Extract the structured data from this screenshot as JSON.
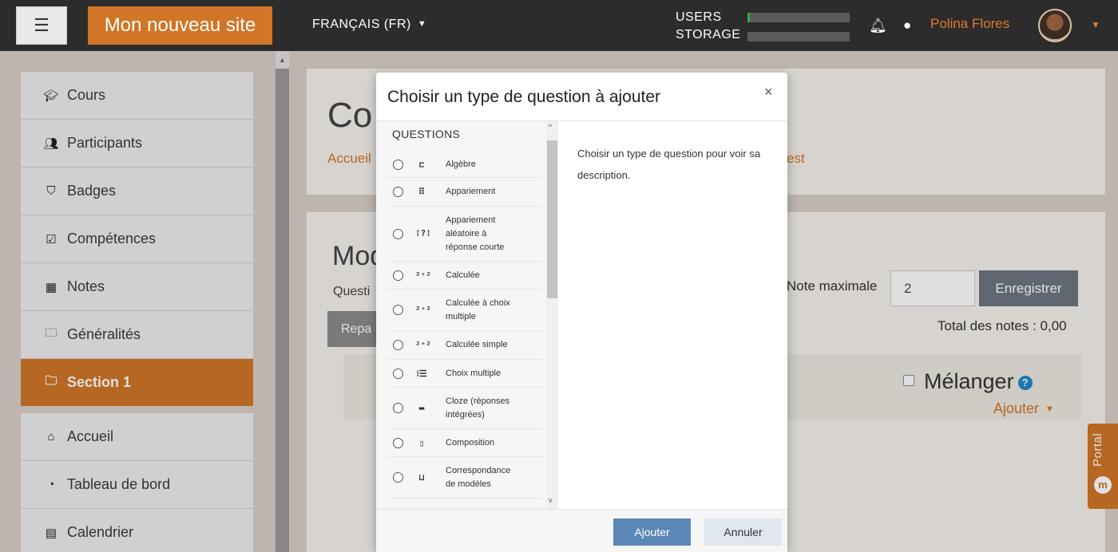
{
  "navbar": {
    "menu_icon": "hamburger-icon",
    "site_name": "Mon nouveau site",
    "language": "FRANÇAIS (FR)",
    "usage": {
      "users_label": "USERS",
      "storage_label": "STORAGE",
      "users_fraction": 0.02,
      "storage_fraction": 0.0,
      "bar_color": "#2fa84f"
    },
    "user_name": "Polina Flores",
    "brand_color": "#d07626"
  },
  "sidebar": {
    "items": [
      {
        "label": "Cours",
        "icon": "graduation-cap-icon"
      },
      {
        "label": "Participants",
        "icon": "users-icon"
      },
      {
        "label": "Badges",
        "icon": "shield-icon"
      },
      {
        "label": "Compétences",
        "icon": "checkbox-icon"
      },
      {
        "label": "Notes",
        "icon": "table-icon"
      },
      {
        "label": "Généralités",
        "icon": "folder-icon"
      },
      {
        "label": "Section 1",
        "icon": "folder-icon",
        "active": true
      },
      {
        "label": "Accueil",
        "icon": "home-icon"
      },
      {
        "label": "Tableau de bord",
        "icon": "dashboard-icon"
      },
      {
        "label": "Calendrier",
        "icon": "calendar-icon"
      }
    ]
  },
  "page": {
    "title_partial": "Co",
    "breadcrumb_start": "Accueil",
    "breadcrumb_end": "est",
    "heading_partial": "Mod",
    "questions_partial": "Questi",
    "repaginate_partial": "Repa",
    "max_grade_label": "Note maximale",
    "max_grade_value": "2",
    "save_label": "Enregistrer",
    "total_label": "Total des notes : 0,00",
    "shuffle_label": "Mélanger",
    "add_label": "Ajouter",
    "portal_label": "Portal"
  },
  "modal": {
    "title": "Choisir un type de question à ajouter",
    "close_glyph": "×",
    "section_header": "QUESTIONS",
    "questions": [
      {
        "label": "Algèbre",
        "icon": "algebra-icon",
        "glyph": "⊏"
      },
      {
        "label": "Appariement",
        "icon": "matching-icon",
        "glyph": "⠿"
      },
      {
        "label": "Appariement aléatoire à réponse courte",
        "icon": "random-matching-icon",
        "glyph": "⁞?⁞"
      },
      {
        "label": "Calculée",
        "icon": "calculated-icon",
        "glyph": "²⁺²"
      },
      {
        "label": "Calculée à choix multiple",
        "icon": "calculated-multichoice-icon",
        "glyph": "²⁺²"
      },
      {
        "label": "Calculée simple",
        "icon": "calculated-simple-icon",
        "glyph": "²⁺²"
      },
      {
        "label": "Choix multiple",
        "icon": "multichoice-icon",
        "glyph": "⁝☰"
      },
      {
        "label": "Cloze (réponses intégrées)",
        "icon": "cloze-icon",
        "glyph": "▬"
      },
      {
        "label": "Composition",
        "icon": "essay-icon",
        "glyph": "▯"
      },
      {
        "label": "Correspondance de modèles",
        "icon": "pattern-match-icon",
        "glyph": "⊔"
      }
    ],
    "description": "Choisir un type de question pour voir sa description.",
    "add_button": "Ajouter",
    "cancel_button": "Annuler"
  }
}
